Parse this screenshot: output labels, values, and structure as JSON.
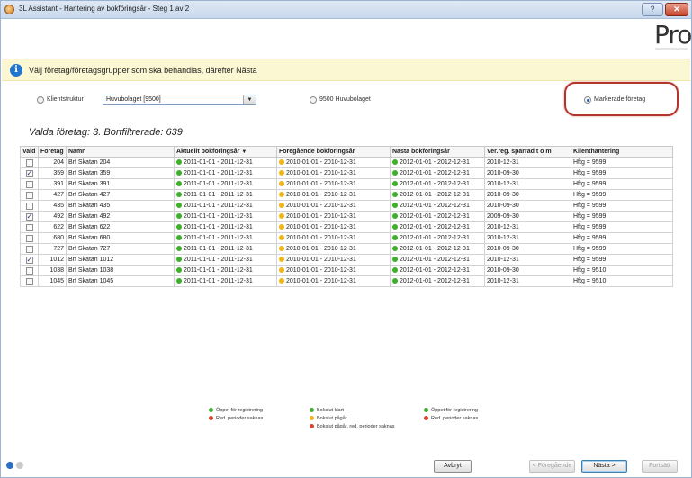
{
  "window": {
    "title": "3L Assistant - Hantering av bokföringsår - Steg 1 av 2",
    "help_label": "?",
    "close_label": "✕",
    "brand": "Pro"
  },
  "info": {
    "text": "Välj företag/företagsgrupper som ska behandlas, därefter Nästa",
    "icon_glyph": "i"
  },
  "options": {
    "klientstruktur_label": "Klientstruktur",
    "klientstruktur_value": "Huvubolaget [9500]",
    "combo_arrow": "▼",
    "huvubolaget_label": "9500 Huvubolaget",
    "markerade_label": "Markerade företag",
    "selected": "markerade"
  },
  "selection_info": "Valda företag: 3. Bortfiltrerade: 639",
  "table": {
    "columns": [
      "Vald",
      "Företag",
      "Namn",
      "Aktuellt bokföringsår",
      "Föregående bokföringsår",
      "Nästa bokföringsår",
      "Ver.reg. spärrad t o m",
      "Klienthantering"
    ],
    "sort_arrow": "▼",
    "rows": [
      {
        "checked": false,
        "nr": "204",
        "name": "Brf Skatan 204",
        "current": "2011-01-01 - 2011-12-31",
        "previous": "2010-01-01 - 2010-12-31",
        "next": "2012-01-01 - 2012-12-31",
        "locked": "2010-12-31",
        "client": "Hftg = 9599"
      },
      {
        "checked": true,
        "nr": "359",
        "name": "Brf Skatan 359",
        "current": "2011-01-01 - 2011-12-31",
        "previous": "2010-01-01 - 2010-12-31",
        "next": "2012-01-01 - 2012-12-31",
        "locked": "2010-09-30",
        "client": "Hftg = 9599"
      },
      {
        "checked": false,
        "nr": "391",
        "name": "Brf Skatan 391",
        "current": "2011-01-01 - 2011-12-31",
        "previous": "2010-01-01 - 2010-12-31",
        "next": "2012-01-01 - 2012-12-31",
        "locked": "2010-12-31",
        "client": "Hftg = 9599"
      },
      {
        "checked": false,
        "nr": "427",
        "name": "Brf Skatan 427",
        "current": "2011-01-01 - 2011-12-31",
        "previous": "2010-01-01 - 2010-12-31",
        "next": "2012-01-01 - 2012-12-31",
        "locked": "2010-09-30",
        "client": "Hftg = 9599"
      },
      {
        "checked": false,
        "nr": "435",
        "name": "Brf Skatan 435",
        "current": "2011-01-01 - 2011-12-31",
        "previous": "2010-01-01 - 2010-12-31",
        "next": "2012-01-01 - 2012-12-31",
        "locked": "2010-09-30",
        "client": "Hftg = 9599"
      },
      {
        "checked": true,
        "nr": "492",
        "name": "Brf Skatan 492",
        "current": "2011-01-01 - 2011-12-31",
        "previous": "2010-01-01 - 2010-12-31",
        "next": "2012-01-01 - 2012-12-31",
        "locked": "2009-09-30",
        "client": "Hftg = 9599"
      },
      {
        "checked": false,
        "nr": "622",
        "name": "Brf Skatan 622",
        "current": "2011-01-01 - 2011-12-31",
        "previous": "2010-01-01 - 2010-12-31",
        "next": "2012-01-01 - 2012-12-31",
        "locked": "2010-12-31",
        "client": "Hftg = 9599"
      },
      {
        "checked": false,
        "nr": "680",
        "name": "Brf Skatan 680",
        "current": "2011-01-01 - 2011-12-31",
        "previous": "2010-01-01 - 2010-12-31",
        "next": "2012-01-01 - 2012-12-31",
        "locked": "2010-12-31",
        "client": "Hftg = 9599"
      },
      {
        "checked": false,
        "nr": "727",
        "name": "Brf Skatan 727",
        "current": "2011-01-01 - 2011-12-31",
        "previous": "2010-01-01 - 2010-12-31",
        "next": "2012-01-01 - 2012-12-31",
        "locked": "2010-09-30",
        "client": "Hftg = 9599"
      },
      {
        "checked": true,
        "nr": "1012",
        "name": "Brf Skatan 1012",
        "current": "2011-01-01 - 2011-12-31",
        "previous": "2010-01-01 - 2010-12-31",
        "next": "2012-01-01 - 2012-12-31",
        "locked": "2010-12-31",
        "client": "Hftg = 9599"
      },
      {
        "checked": false,
        "nr": "1038",
        "name": "Brf Skatan 1038",
        "current": "2011-01-01 - 2011-12-31",
        "previous": "2010-01-01 - 2010-12-31",
        "next": "2012-01-01 - 2012-12-31",
        "locked": "2010-09-30",
        "client": "Hftg = 9510"
      },
      {
        "checked": false,
        "nr": "1045",
        "name": "Brf Skatan 1045",
        "current": "2011-01-01 - 2011-12-31",
        "previous": "2010-01-01 - 2010-12-31",
        "next": "2012-01-01 - 2012-12-31",
        "locked": "2010-12-31",
        "client": "Hftg = 9510"
      }
    ]
  },
  "status_colors": {
    "green": "#3fae2a",
    "yellow": "#f0b41c",
    "red": "#d9432f"
  },
  "legend": {
    "col1": [
      {
        "color": "green",
        "label": "Öppet för registrering"
      },
      {
        "color": "red",
        "label": "Red. perioder saknas"
      }
    ],
    "col2": [
      {
        "color": "green",
        "label": "Bokslut klart"
      },
      {
        "color": "yellow",
        "label": "Bokslut pågår"
      },
      {
        "color": "red",
        "label": "Bokslut pågår, red. perioder saknas"
      }
    ],
    "col3": [
      {
        "color": "green",
        "label": "Öppet för registrering"
      },
      {
        "color": "red",
        "label": "Red. perioder saknas"
      }
    ]
  },
  "buttons": {
    "cancel": "Avbryt",
    "previous": "< Föregående",
    "next": "Nästa >",
    "continue": "Fortsätt"
  }
}
